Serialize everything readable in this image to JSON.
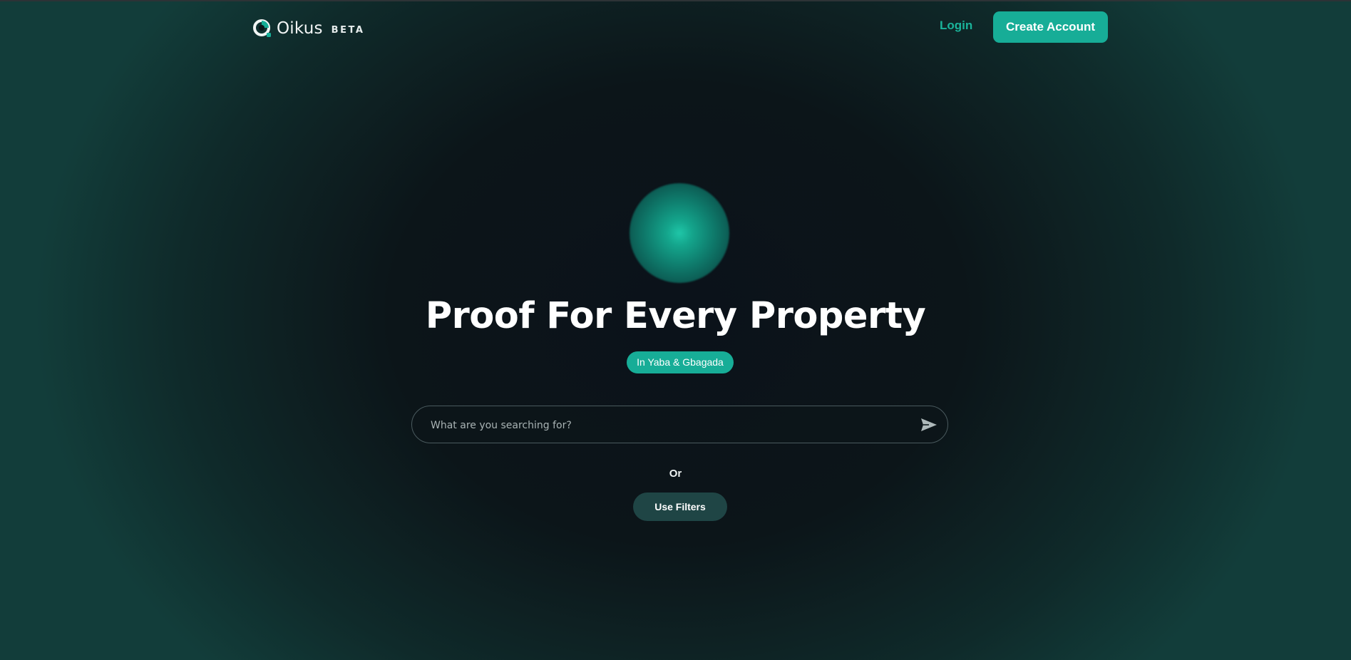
{
  "colors": {
    "accent": "#17ad97",
    "background": "#0c1519",
    "filters_button": "#1f4545"
  },
  "header": {
    "logo_name": "Oikus",
    "logo_tag": "BETA",
    "login_label": "Login",
    "create_account_label": "Create Account"
  },
  "hero": {
    "title": "Proof For Every Property",
    "location_badge": "In Yaba & Gbagada"
  },
  "search": {
    "placeholder": "What are you searching for?",
    "value": "",
    "submit_icon": "send-icon"
  },
  "alternative": {
    "or_label": "Or",
    "filters_label": "Use Filters"
  }
}
